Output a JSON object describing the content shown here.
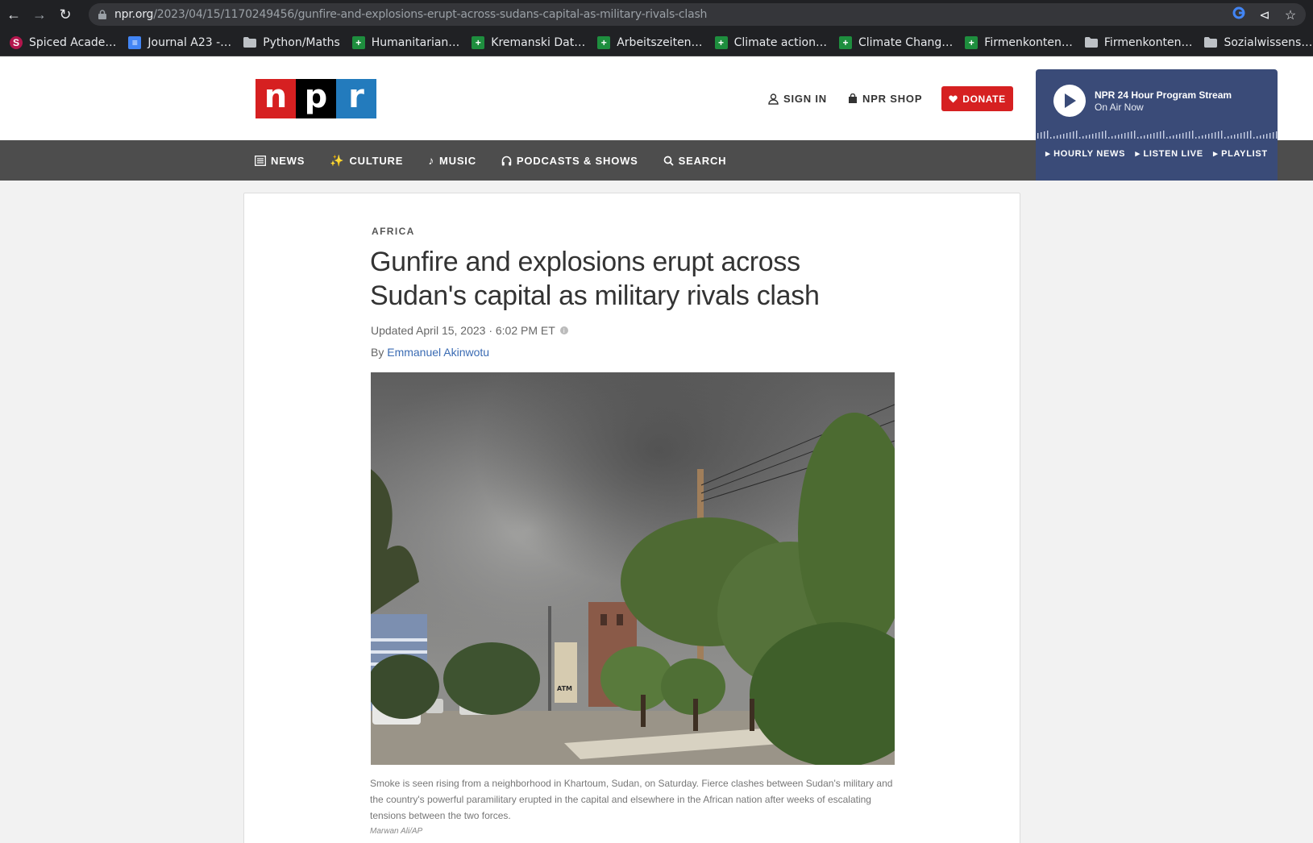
{
  "browser": {
    "url_host": "npr.org",
    "url_path": "/2023/04/15/1170249456/gunfire-and-explosions-erupt-across-sudans-capital-as-military-rivals-clash"
  },
  "bookmarks": [
    {
      "label": "Spiced Acade…",
      "icon": "spiced-icon"
    },
    {
      "label": "Journal A23 -…",
      "icon": "docs-icon"
    },
    {
      "label": "Python/Maths",
      "icon": "folder-icon"
    },
    {
      "label": "Humanitarian…",
      "icon": "sheet-icon"
    },
    {
      "label": "Kremanski Dat…",
      "icon": "sheet-icon"
    },
    {
      "label": "Arbeitszeiten…",
      "icon": "sheet-icon"
    },
    {
      "label": "Climate action…",
      "icon": "sheet-icon"
    },
    {
      "label": "Climate Chang…",
      "icon": "sheet-icon"
    },
    {
      "label": "Firmenkonten…",
      "icon": "sheet-icon"
    },
    {
      "label": "Firmenkonten…",
      "icon": "folder-icon"
    },
    {
      "label": "Sozialwissens…",
      "icon": "folder-icon"
    }
  ],
  "header": {
    "logo": [
      "n",
      "p",
      "r"
    ],
    "sign_in": "SIGN IN",
    "shop": "NPR SHOP",
    "donate": "DONATE"
  },
  "stream": {
    "title": "NPR 24 Hour Program Stream",
    "subtitle": "On Air Now",
    "links": [
      "HOURLY NEWS",
      "LISTEN LIVE",
      "PLAYLIST"
    ]
  },
  "nav": {
    "news": "NEWS",
    "culture": "CULTURE",
    "music": "MUSIC",
    "podcasts": "PODCASTS & SHOWS",
    "search": "SEARCH"
  },
  "article": {
    "slug": "AFRICA",
    "headline": "Gunfire and explosions erupt across Sudan's capital as military rivals clash",
    "dateline": "Updated April 15, 2023 · 6:02 PM ET",
    "byline_prefix": "By ",
    "author": "Emmanuel Akinwotu",
    "caption": "Smoke is seen rising from a neighborhood in Khartoum, Sudan, on Saturday. Fierce clashes between Sudan's military and the country's powerful paramilitary erupted in the capital and elsewhere in the African nation after weeks of escalating tensions between the two forces.",
    "credit": "Marwan Ali/AP"
  },
  "photo_signs": {
    "atm": "ATM"
  },
  "colors": {
    "npr_red": "#d62021",
    "npr_blue": "#237bbd",
    "stream_bg": "#3a4b78",
    "nav_bg": "#4d4d4d",
    "link": "#3a6bb3"
  }
}
